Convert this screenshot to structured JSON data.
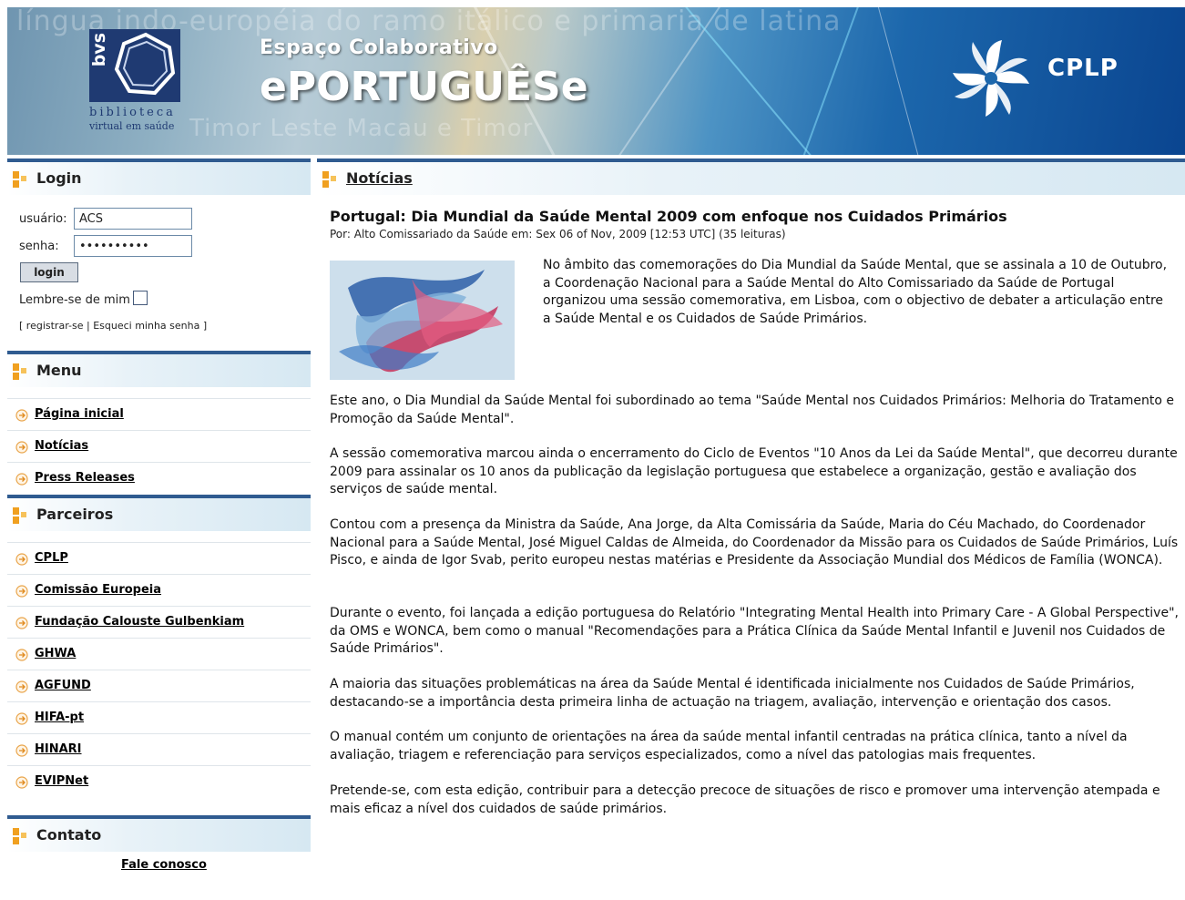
{
  "banner": {
    "bvs_letters": "bvs",
    "bvs_name": "biblioteca",
    "bvs_sub": "virtual em saúde",
    "title_small": "Espaço Colaborativo",
    "title_big": "ePORTUGUÊSe",
    "cplp": "CPLP",
    "ghost_text_top": "língua indo-européia do ramo itálico e primaria de latina",
    "ghost_text_bottom": "Timor Leste Macau e Timor"
  },
  "login": {
    "title": "Login",
    "user_label": "usuário:",
    "user_value": "ACS",
    "password_label": "senha:",
    "password_value": "••••••••••",
    "button": "login",
    "remember": "Lembre-se de mim",
    "bracket_open": "[",
    "register": "registrar-se",
    "separator": "|",
    "forgot": "Esqueci minha senha",
    "bracket_close": "]"
  },
  "menu": {
    "title": "Menu",
    "items": [
      "Página inicial",
      "Notícias",
      "Press Releases"
    ]
  },
  "partners": {
    "title": "Parceiros",
    "items": [
      "CPLP",
      "Comissão Europeia",
      "Fundação Calouste Gulbenkiam",
      "GHWA",
      "AGFUND",
      "HIFA-pt",
      "HINARI",
      "EVIPNet"
    ]
  },
  "contact": {
    "title": "Contato",
    "link": "Fale conosco"
  },
  "news": {
    "section_title": "Notícias",
    "article_title": "Portugal: Dia Mundial da Saúde Mental 2009 com enfoque nos Cuidados Primários",
    "meta": "Por: Alto Comissariado da Saúde em: Sex 06 of Nov, 2009 [12:53 UTC] (35 leituras)",
    "intro": "No âmbito das comemorações do Dia Mundial da Saúde Mental, que se assinala a 10 de Outubro, a Coordenação Nacional para a Saúde Mental do Alto Comissariado da Saúde de Portugal organizou uma sessão comemorativa, em Lisboa, com o objectivo de debater a articulação entre a Saúde Mental e os Cuidados de Saúde Primários.",
    "paragraphs": [
      "Este ano, o Dia Mundial da Saúde Mental foi subordinado ao tema \"Saúde Mental nos Cuidados Primários: Melhoria do Tratamento e Promoção da Saúde Mental\".",
      "A sessão comemorativa marcou ainda o encerramento do Ciclo de Eventos \"10 Anos da Lei da Saúde Mental\", que decorreu durante 2009 para assinalar os 10 anos da publicação da legislação portuguesa que estabelece a organização, gestão e avaliação dos serviços de saúde mental.",
      "Contou com a presença da Ministra da Saúde, Ana Jorge, da Alta Comissária da Saúde, Maria do Céu Machado, do Coordenador Nacional para a Saúde Mental, José Miguel Caldas de Almeida, do Coordenador da Missão para os Cuidados de Saúde Primários, Luís Pisco, e ainda de Igor Svab, perito europeu nestas matérias e Presidente da Associação Mundial dos Médicos de Família (WONCA).",
      "Durante o evento, foi lançada a edição portuguesa do Relatório \"Integrating Mental Health into Primary Care - A Global Perspective\", da OMS e WONCA, bem como o manual \"Recomendações para a Prática Clínica da Saúde Mental Infantil e Juvenil nos Cuidados de Saúde Primários\".",
      "A maioria das situações problemáticas na área da Saúde Mental é identificada inicialmente nos Cuidados de Saúde Primários, destacando-se a importância desta primeira linha de actuação na triagem, avaliação, intervenção e orientação dos casos.",
      "O manual contém um conjunto de orientações na área da saúde mental infantil centradas na prática clínica, tanto a nível da avaliação, triagem e referenciação para serviços especializados, como a nível das patologias mais frequentes.",
      "Pretende-se, com esta edição, contribuir para a detecção precoce de situações de risco e promover uma intervenção atempada e mais eficaz a nível dos cuidados de saúde primários."
    ]
  },
  "icons": {
    "section_icon": "orange-blocks-icon",
    "link_icon": "arrow-circle-icon",
    "accent_orange": "#f0a020",
    "header_blue": "#2f5b90"
  }
}
